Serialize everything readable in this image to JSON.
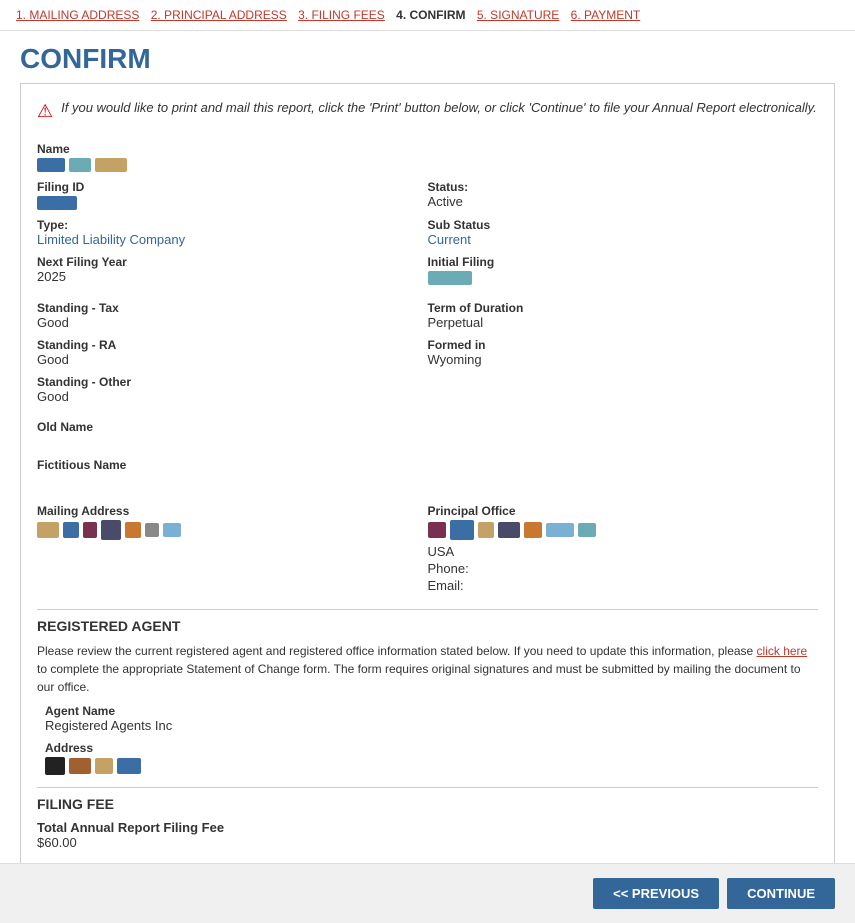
{
  "nav": {
    "items": [
      {
        "id": "mailing",
        "label": "1. MAILING ADDRESS",
        "active": false
      },
      {
        "id": "principal",
        "label": "2. PRINCIPAL ADDRESS",
        "active": false
      },
      {
        "id": "filing-fees",
        "label": "3. FILING FEES",
        "active": false
      },
      {
        "id": "confirm",
        "label": "4. CONFIRM",
        "active": true
      },
      {
        "id": "signature",
        "label": "5. SIGNATURE",
        "active": false
      },
      {
        "id": "payment",
        "label": "6. PAYMENT",
        "active": false
      }
    ]
  },
  "page": {
    "title": "CONFIRM"
  },
  "warning": {
    "text": "If you would like to print and mail this report, click the 'Print' button below, or click 'Continue' to file your Annual Report electronically."
  },
  "fields": {
    "name_label": "Name",
    "filing_id_label": "Filing ID",
    "status_label": "Status:",
    "status_value": "Active",
    "type_label": "Type:",
    "type_value": "Limited Liability Company",
    "sub_status_label": "Sub Status",
    "sub_status_value": "Current",
    "next_filing_year_label": "Next Filing Year",
    "next_filing_year_value": "2025",
    "initial_filing_label": "Initial Filing",
    "standing_tax_label": "Standing - Tax",
    "standing_tax_value": "Good",
    "term_of_duration_label": "Term of Duration",
    "term_of_duration_value": "Perpetual",
    "standing_ra_label": "Standing - RA",
    "standing_ra_value": "Good",
    "formed_in_label": "Formed in",
    "formed_in_value": "Wyoming",
    "standing_other_label": "Standing - Other",
    "standing_other_value": "Good",
    "old_name_label": "Old Name",
    "old_name_value": "",
    "fictitious_name_label": "Fictitious Name",
    "fictitious_name_value": "",
    "mailing_address_label": "Mailing Address",
    "principal_office_label": "Principal Office",
    "principal_usa": "USA",
    "principal_phone_label": "Phone:",
    "principal_phone_value": "",
    "principal_email_label": "Email:",
    "principal_email_value": ""
  },
  "registered_agent": {
    "section_heading": "REGISTERED AGENT",
    "description_part1": "Please review the current registered agent and registered office information stated below. If you need to update this information, please ",
    "link_text": "click here",
    "description_part2": " to complete the appropriate Statement of Change form. The form requires original signatures and must be submitted by mailing the document to our office.",
    "agent_name_label": "Agent Name",
    "agent_name_value": "Registered Agents Inc",
    "address_label": "Address"
  },
  "filing_fee": {
    "section_heading": "FILING FEE",
    "fee_label": "Total Annual Report Filing Fee",
    "fee_value": "$60.00"
  },
  "buttons": {
    "previous": "<< PREVIOUS",
    "continue": "CONTINUE"
  }
}
